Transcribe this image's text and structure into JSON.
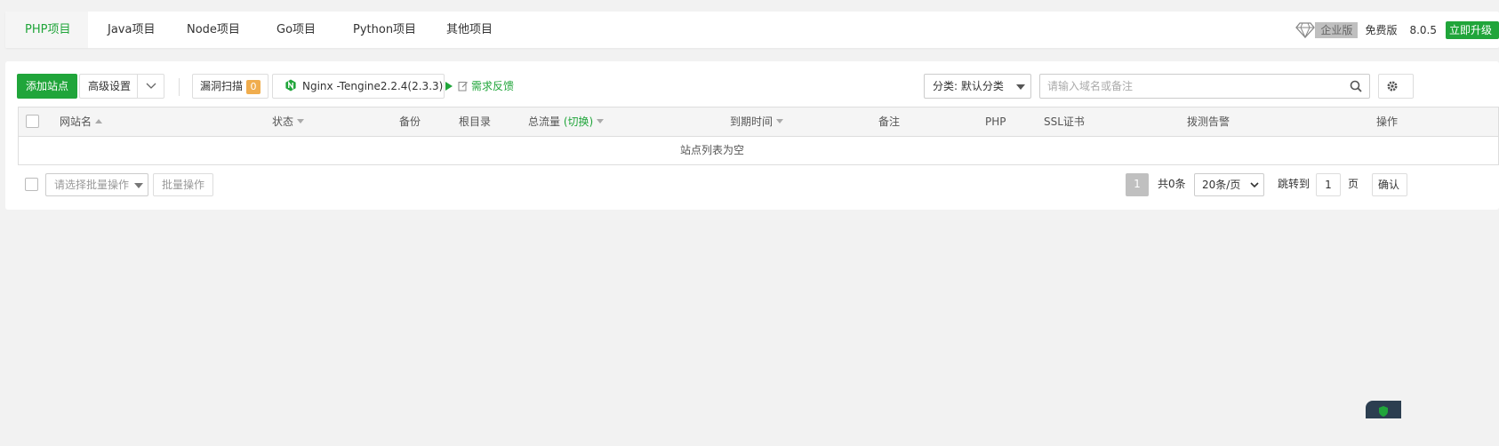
{
  "tabs": [
    {
      "label": "PHP项目",
      "active": true
    },
    {
      "label": "Java项目",
      "active": false
    },
    {
      "label": "Node项目",
      "active": false
    },
    {
      "label": "Go项目",
      "active": false
    },
    {
      "label": "Python项目",
      "active": false
    },
    {
      "label": "其他项目",
      "active": false
    }
  ],
  "header": {
    "enterprise_label": "企业版",
    "free_label": "免费版",
    "version": "8.0.5",
    "upgrade_label": "立即升级"
  },
  "toolbar": {
    "add_site_label": "添加站点",
    "advanced_label": "高级设置",
    "vuln_scan_label": "漏洞扫描",
    "vuln_count": "0",
    "nginx_label": "Nginx -Tengine2.2.4(2.3.3)",
    "feedback_label": "需求反馈",
    "category_label": "分类: 默认分类",
    "search_placeholder": "请输入域名或备注"
  },
  "table": {
    "columns": {
      "site_name": "网站名",
      "status": "状态",
      "backup": "备份",
      "root_dir": "根目录",
      "traffic": "总流量",
      "traffic_switch": "(切换)",
      "expire": "到期时间",
      "remark": "备注",
      "php": "PHP",
      "ssl": "SSL证书",
      "probe": "拨测告警",
      "actions": "操作"
    },
    "empty_text": "站点列表为空"
  },
  "footer": {
    "batch_placeholder": "请选择批量操作",
    "batch_button": "批量操作",
    "current_page": "1",
    "total_text": "共0条",
    "page_size": "20条/页",
    "jump_label": "跳转到",
    "jump_value": "1",
    "page_unit": "页",
    "confirm_label": "确认"
  },
  "colors": {
    "brand_green": "#20a53a",
    "badge_orange": "#f0ad4e"
  }
}
